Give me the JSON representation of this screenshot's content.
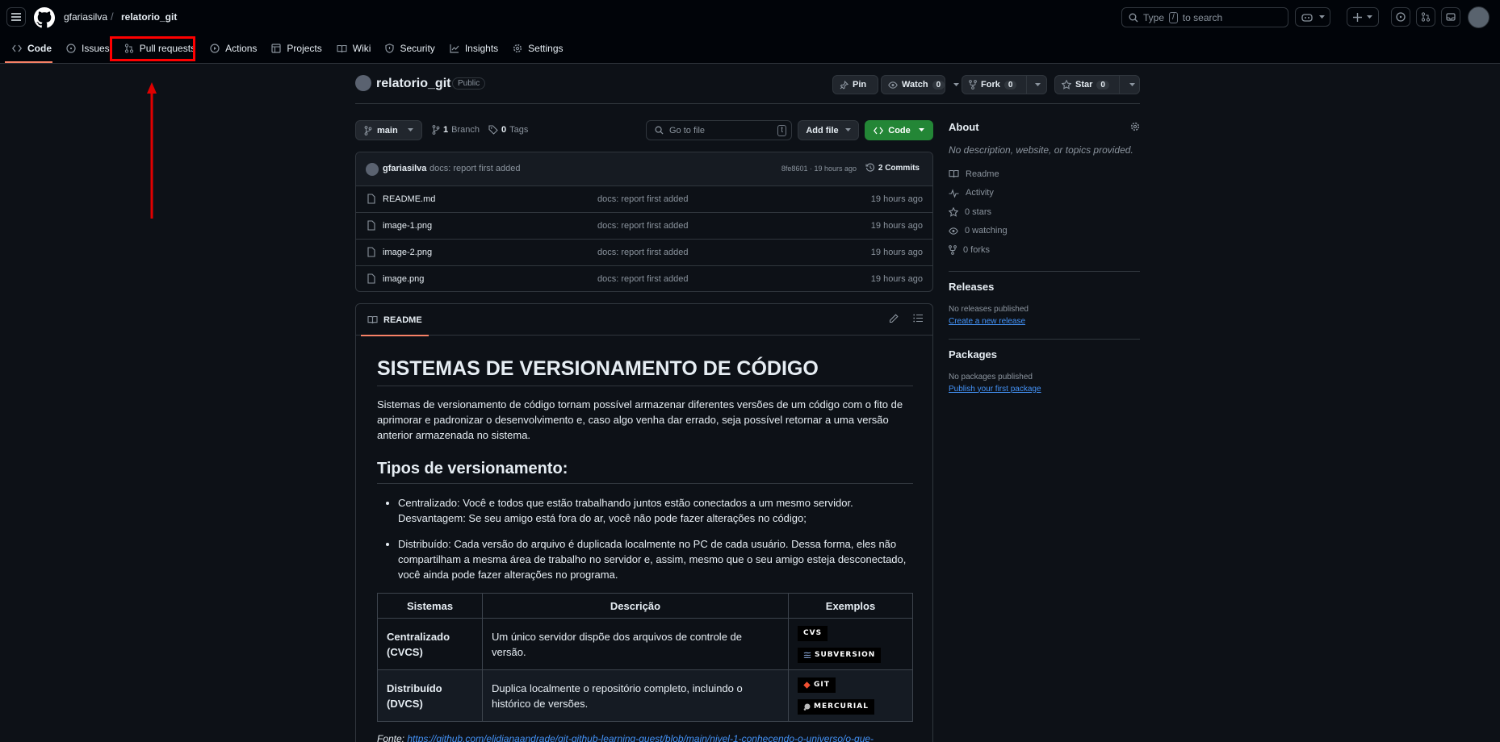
{
  "header": {
    "owner": "gfariasilva",
    "separator": "/",
    "repo": "relatorio_git",
    "search_prefix": "Type",
    "search_key": "/",
    "search_suffix": "to search"
  },
  "nav": {
    "code": "Code",
    "issues": "Issues",
    "pull_requests": "Pull requests",
    "actions": "Actions",
    "projects": "Projects",
    "wiki": "Wiki",
    "security": "Security",
    "insights": "Insights",
    "settings": "Settings"
  },
  "repo": {
    "name": "relatorio_git",
    "visibility": "Public",
    "pin": "Pin",
    "watch": "Watch",
    "watch_count": "0",
    "fork": "Fork",
    "fork_count": "0",
    "star": "Star",
    "star_count": "0"
  },
  "branch": {
    "name": "main",
    "branch_count": "1",
    "branch_label": "Branch",
    "tag_count": "0",
    "tag_label": "Tags",
    "goto_placeholder": "Go to file",
    "goto_key": "t",
    "add_file": "Add file",
    "code": "Code"
  },
  "commit": {
    "user": "gfariasilva",
    "message": "docs: report first added",
    "hash_time": "8fe8601 · 19 hours ago",
    "commits": "2 Commits"
  },
  "files": [
    {
      "name": "README.md",
      "message": "docs: report first added",
      "time": "19 hours ago"
    },
    {
      "name": "image-1.png",
      "message": "docs: report first added",
      "time": "19 hours ago"
    },
    {
      "name": "image-2.png",
      "message": "docs: report first added",
      "time": "19 hours ago"
    },
    {
      "name": "image.png",
      "message": "docs: report first added",
      "time": "19 hours ago"
    }
  ],
  "readme": {
    "tab": "README",
    "h1": "SISTEMAS DE VERSIONAMENTO DE CÓDIGO",
    "intro": "Sistemas de versionamento de código tornam possível armazenar diferentes versões de um código com o fito de aprimorar e padronizar o desenvolvimento e, caso algo venha dar errado, seja possível retornar a uma versão anterior armazenada no sistema.",
    "h2": "Tipos de versionamento:",
    "bullets": [
      "Centralizado: Você e todos que estão trabalhando juntos estão conectados a um mesmo servidor. Desvantagem: Se seu amigo está fora do ar, você não pode fazer alterações no código;",
      "Distribuído: Cada versão do arquivo é duplicada localmente no PC de cada usuário. Dessa forma, eles não compartilham a mesma área de trabalho no servidor e, assim, mesmo que o seu amigo esteja desconectado, você ainda pode fazer alterações no programa."
    ],
    "table": {
      "headers": [
        "Sistemas",
        "Descrição",
        "Exemplos"
      ],
      "rows": [
        {
          "system": "Centralizado (CVCS)",
          "description": "Um único servidor dispõe dos arquivos de controle de versão.",
          "examples": [
            "CVS",
            "SUBVERSION"
          ]
        },
        {
          "system": "Distribuído (DVCS)",
          "description": "Duplica localmente o repositório completo, incluindo o histórico de versões.",
          "examples": [
            "GIT",
            "MERCURIAL"
          ]
        }
      ]
    },
    "fonte_label": "Fonte:",
    "fonte_link": "https://github.com/elidianaandrade/git-github-learning-quest/blob/main/nivel-1-conhecendo-o-universo/o-que-"
  },
  "sidebar": {
    "about": "About",
    "description": "No description, website, or topics provided.",
    "readme": "Readme",
    "activity": "Activity",
    "stars": "0 stars",
    "watching": "0 watching",
    "forks": "0 forks",
    "releases": "Releases",
    "no_releases": "No releases published",
    "create_release": "Create a new release",
    "packages": "Packages",
    "no_packages": "No packages published",
    "publish_package": "Publish your first package"
  },
  "colors": {
    "highlight": "#ff0000",
    "accent_green": "#238636",
    "link": "#4493f8"
  }
}
